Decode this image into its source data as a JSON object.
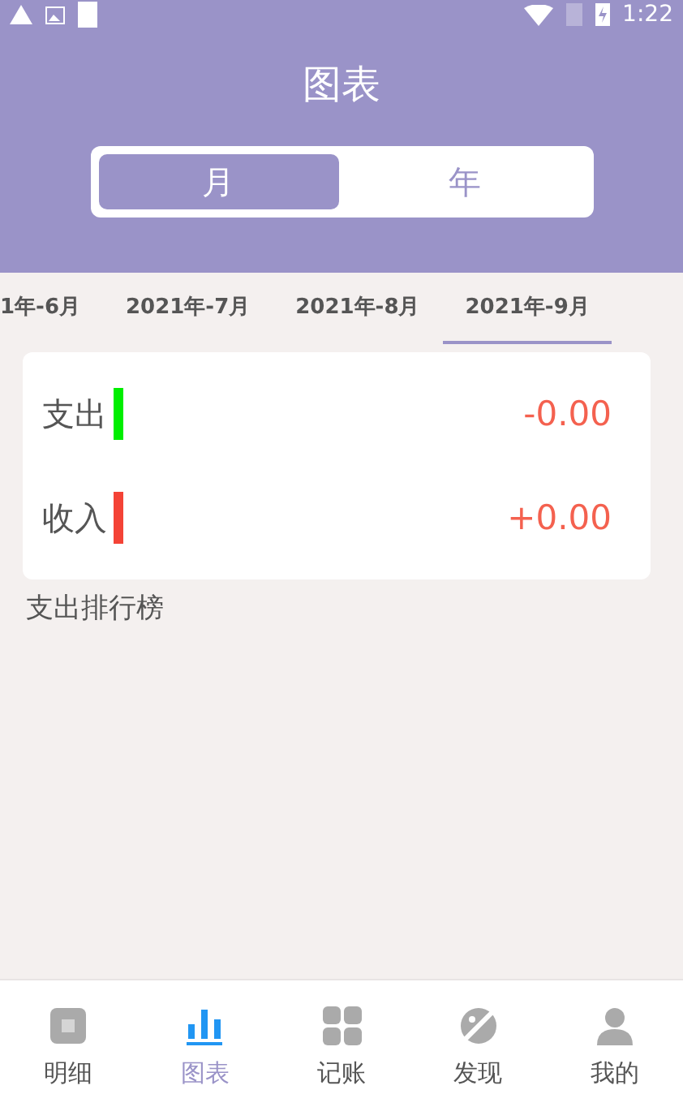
{
  "status_bar": {
    "time": "1:22"
  },
  "header": {
    "title": "图表"
  },
  "period_toggle": [
    {
      "label": "月",
      "selected": true
    },
    {
      "label": "年",
      "selected": false
    }
  ],
  "months": [
    {
      "label": "1年-6月",
      "selected": false
    },
    {
      "label": "2021年-7月",
      "selected": false
    },
    {
      "label": "2021年-8月",
      "selected": false
    },
    {
      "label": "2021年-9月",
      "selected": true
    }
  ],
  "summary": [
    {
      "label": "支出",
      "color": "#00ee00",
      "amount": "-0.00"
    },
    {
      "label": "收入",
      "color": "#f44336",
      "amount": "+0.00"
    }
  ],
  "ranking_title": "支出排行榜",
  "nav": [
    {
      "kind": "notebook",
      "label": "明细",
      "selected": false
    },
    {
      "kind": "chart",
      "label": "图表",
      "selected": true
    },
    {
      "kind": "grid",
      "label": "记账",
      "selected": false
    },
    {
      "kind": "planet",
      "label": "发现",
      "selected": false
    },
    {
      "kind": "person",
      "label": "我的",
      "selected": false
    }
  ]
}
